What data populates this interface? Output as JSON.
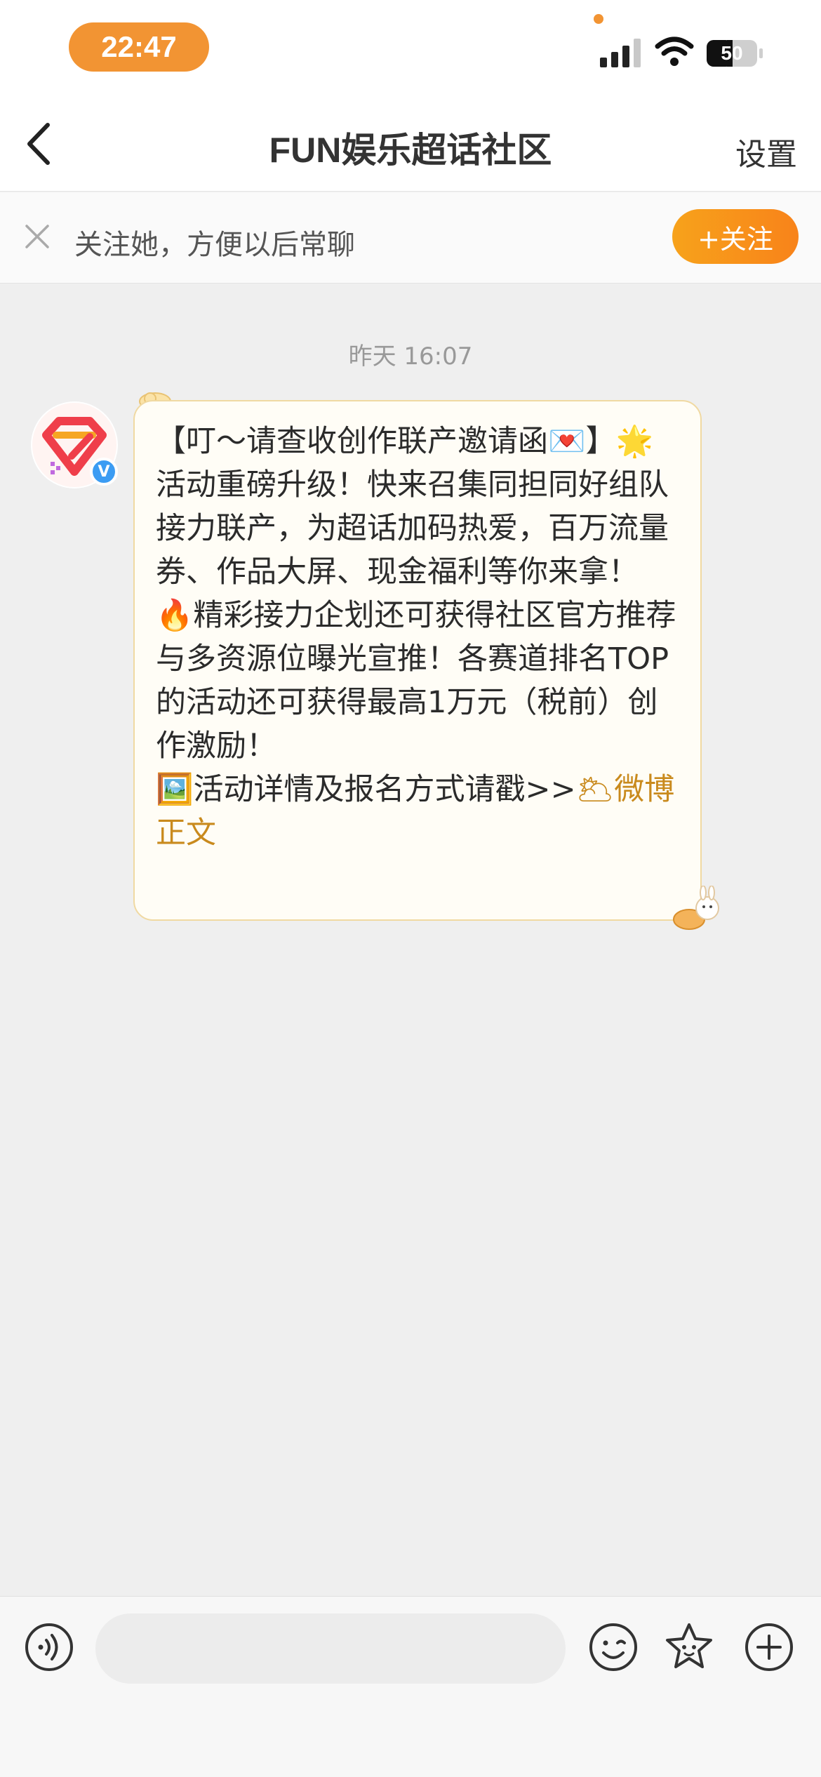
{
  "status_bar": {
    "time": "22:47",
    "battery": "50"
  },
  "nav": {
    "title": "FUN娱乐超话社区",
    "settings_label": "设置"
  },
  "follow_bar": {
    "prompt": "关注她，方便以后常聊",
    "follow_label": "+关注"
  },
  "chat": {
    "timestamp": "昨天 16:07",
    "message": {
      "text": "【叮～请查收创作联产邀请函💌】🌟\n活动重磅升级！快来召集同担同好组队接力联产，为超话加码热爱，百万流量券、作品大屏、现金福利等你来拿！\n🔥精彩接力企划还可获得社区官方推荐与多资源位曝光宣推！各赛道排名TOP的活动还可获得最高1万元（税前）创作激励！\n🖼️活动详情及报名方式请戳>>",
      "link_text": "🌥微博正文"
    }
  },
  "input_bar": {
    "placeholder": ""
  },
  "colors": {
    "accent": "#f29433",
    "link": "#c98a1d",
    "bubble_bg": "#fffdf6",
    "bubble_border": "#f0d9a2",
    "verified": "#3b9cf3"
  },
  "icons": [
    "signal-icon",
    "wifi-icon",
    "battery-icon",
    "back-arrow-icon",
    "close-icon",
    "voice-icon",
    "emoji-icon",
    "sticker-icon",
    "plus-icon"
  ]
}
